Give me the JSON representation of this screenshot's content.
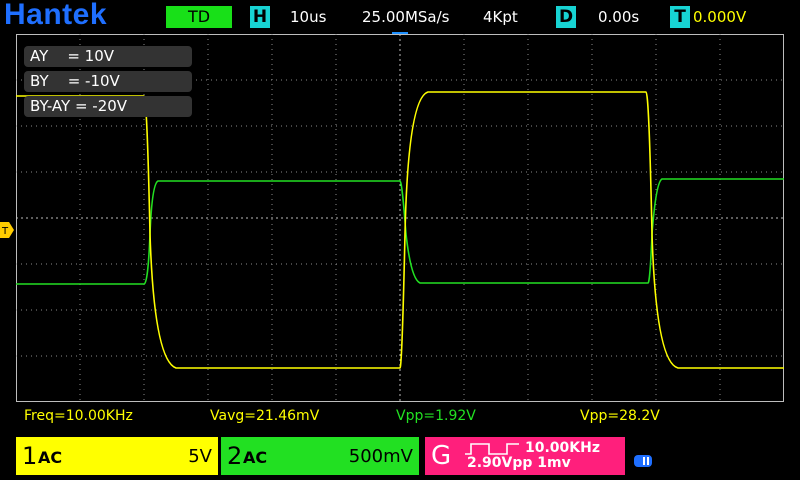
{
  "header": {
    "brand": "Hantek",
    "mode": "TD",
    "h_icon": "H",
    "timebase": "10us",
    "sample_rate": "25.00MSa/s",
    "memory_depth": "4Kpt",
    "d_icon": "D",
    "delay": "0.00s",
    "t_icon": "T",
    "trigger_level": "0.000V"
  },
  "math_labels": [
    "AY    = 10V",
    "BY    = -10V",
    "BY-AY = -20V"
  ],
  "measurements": {
    "freq": "Freq=10.00KHz",
    "vavg": "Vavg=21.46mV",
    "vpp2": "Vpp=1.92V",
    "vpp1": "Vpp=28.2V"
  },
  "channels": {
    "ch1": {
      "num": "1",
      "coupling": "AC",
      "scale": "5V"
    },
    "ch2": {
      "num": "2",
      "coupling": "AC",
      "scale": "500mV"
    },
    "gen": {
      "letter": "G",
      "freq": "10.00KHz",
      "amplitude": "2.90Vpp  1mv"
    }
  },
  "markers": {
    "trigger_left": "T"
  },
  "colors": {
    "ch1": "#ffff00",
    "ch2": "#22e022",
    "generator": "#ff1f7c",
    "brand": "#1f6fff",
    "icon": "#17d3d3",
    "trigger_marker": "#1e90ff"
  },
  "icons": {
    "battery": "battery-icon",
    "trigger_position": "trigger-position-icon"
  }
}
